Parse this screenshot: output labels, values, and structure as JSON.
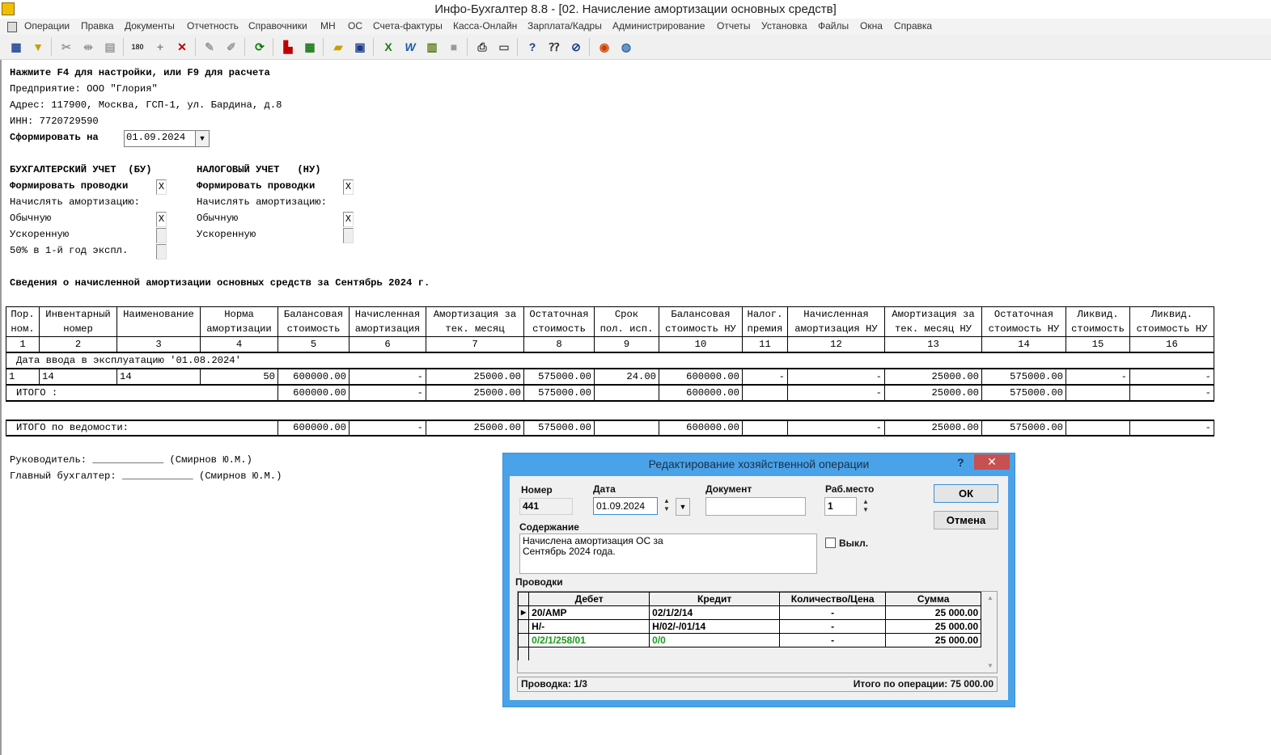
{
  "window": {
    "title": "Инфо-Бухгалтер 8.8 - [02.  Начисление амортизации основных средств]"
  },
  "menu": [
    "Операции",
    "Правка",
    "Документы",
    "Отчетность",
    "Справочники",
    "МН",
    "ОС",
    "Счета-фактуры",
    "Касса-Онлайн",
    "Зарплата/Кадры",
    "Администрирование",
    "Отчеты",
    "Установка",
    "Файлы",
    "Окна",
    "Справка"
  ],
  "report": {
    "hint": "Нажмите F4 для настройки, или F9 для расчета",
    "enterprise": "Предприятие: ООО \"Глория\"",
    "address": "Адрес: 117900, Москва, ГСП-1, ул. Бардина, д.8",
    "inn": "ИНН: 7720729590",
    "form_on_label": "Сформировать на",
    "form_on_date": "01.09.2024",
    "bu_header": "БУХГАЛТЕРСКИЙ УЧЕТ  (БУ)",
    "nu_header": "НАЛОГОВЫЙ УЧЕТ   (НУ)",
    "bu": {
      "make_postings": "Формировать проводки",
      "accrue": "Начислять амортизацию:",
      "normal": "Обычную",
      "accelerated": "Ускоренную",
      "half_first_year": "50% в 1-й год экспл.",
      "make_postings_checked": "X",
      "normal_checked": "X"
    },
    "nu": {
      "make_postings": "Формировать проводки",
      "accrue": "Начислять амортизацию:",
      "normal": "Обычную",
      "accelerated": "Ускоренную",
      "make_postings_checked": "X",
      "normal_checked": "X"
    },
    "section_title": "Сведения о начисленной амортизации основных средств за Сентябрь 2024 г.",
    "columns": [
      [
        "Пор.",
        "ном."
      ],
      [
        "Инвентарный",
        "номер"
      ],
      [
        "Наименование",
        ""
      ],
      [
        "Норма",
        "амортизации"
      ],
      [
        "Балансовая",
        "стоимость"
      ],
      [
        "Начисленная",
        "амортизация"
      ],
      [
        "Амортизация за",
        "тек. месяц"
      ],
      [
        "Остаточная",
        "стоимость"
      ],
      [
        "Срок",
        "пол. исп."
      ],
      [
        "Балансовая",
        "стоимость НУ"
      ],
      [
        "Налог.",
        "премия"
      ],
      [
        "Начисленная",
        "амортизация НУ"
      ],
      [
        "Амортизация за",
        "тек. месяц НУ"
      ],
      [
        "Остаточная",
        "стоимость НУ"
      ],
      [
        "Ликвид.",
        "стоимость"
      ],
      [
        "Ликвид.",
        "стоимость НУ"
      ]
    ],
    "column_numbers": [
      "1",
      "2",
      "3",
      "4",
      "5",
      "6",
      "7",
      "8",
      "9",
      "10",
      "11",
      "12",
      "13",
      "14",
      "15",
      "16"
    ],
    "group_title": "Дата ввода в эксплуатацию '01.08.2024'",
    "rows": [
      [
        "1",
        "14",
        "14",
        "50",
        "600000.00",
        "-",
        "25000.00",
        "575000.00",
        "24.00",
        "600000.00",
        "-",
        "-",
        "25000.00",
        "575000.00",
        "-",
        "-"
      ]
    ],
    "total_label": "ИТОГО :",
    "total": [
      "600000.00",
      "-",
      "25000.00",
      "575000.00",
      "",
      "600000.00",
      "",
      "-",
      "25000.00",
      "575000.00",
      "",
      "-"
    ],
    "grand_total_label": "ИТОГО по ведомости:",
    "grand_total": [
      "600000.00",
      "-",
      "25000.00",
      "575000.00",
      "",
      "600000.00",
      "",
      "-",
      "25000.00",
      "575000.00",
      "",
      "-"
    ],
    "director": "Руководитель: ____________ (Смирнов Ю.М.)",
    "chief_accountant": "Главный бухгалтер: ____________ (Смирнов Ю.М.)"
  },
  "dialog": {
    "title": "Редактирование хозяйственной операции",
    "help": "?",
    "close": "✕",
    "number_label": "Номер",
    "number": "441",
    "date_label": "Дата",
    "date": "01.09.2024",
    "document_label": "Документ",
    "document": "",
    "workplace_label": "Раб.место",
    "workplace": "1",
    "ok": "ОК",
    "cancel": "Отмена",
    "content_label": "Содержание",
    "content_line1": "Начислена амортизация ОС за",
    "content_line2": "Сентябрь 2024 года.",
    "off_label": "Выкл.",
    "postings_label": "Проводки",
    "postings_columns": [
      "Дебет",
      "Кредит",
      "Количество/Цена",
      "Сумма"
    ],
    "postings": [
      {
        "debit": "20/АМР",
        "credit": "02/1/2/14",
        "qty": "-",
        "sum": "25 000.00",
        "color": "#000000"
      },
      {
        "debit": "Н/-",
        "credit": "Н/02/-/01/14",
        "qty": "-",
        "sum": "25 000.00",
        "color": "#000000"
      },
      {
        "debit": "0/2/1/258/01",
        "credit": "0/0",
        "qty": "-",
        "sum": "25 000.00",
        "color": "#1a9a1a"
      }
    ],
    "posting_status": "Проводка: 1/3",
    "operation_total": "Итого по операции: 75 000.00"
  }
}
